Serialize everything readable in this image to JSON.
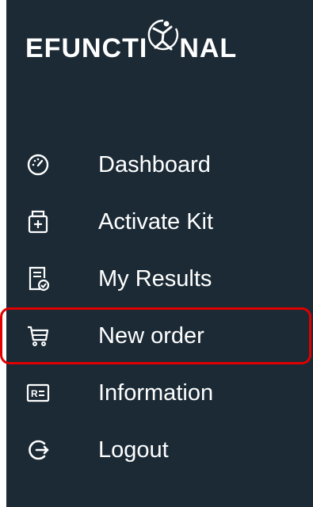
{
  "brand": {
    "left_text": "EFUNCTI",
    "right_text": "NAL",
    "logo_icon": "stick-figure-circle-icon"
  },
  "colors": {
    "sidebar_bg": "#1b2a35",
    "text": "#ffffff",
    "highlight_border": "#e00000"
  },
  "nav": {
    "items": [
      {
        "label": "Dashboard",
        "icon": "speedometer-icon"
      },
      {
        "label": "Activate Kit",
        "icon": "kit-box-plus-icon"
      },
      {
        "label": "My Results",
        "icon": "document-check-icon"
      },
      {
        "label": "New order",
        "icon": "cart-icon",
        "highlighted": true
      },
      {
        "label": "Information",
        "icon": "id-card-icon"
      },
      {
        "label": "Logout",
        "icon": "logout-arrow-icon"
      }
    ]
  }
}
